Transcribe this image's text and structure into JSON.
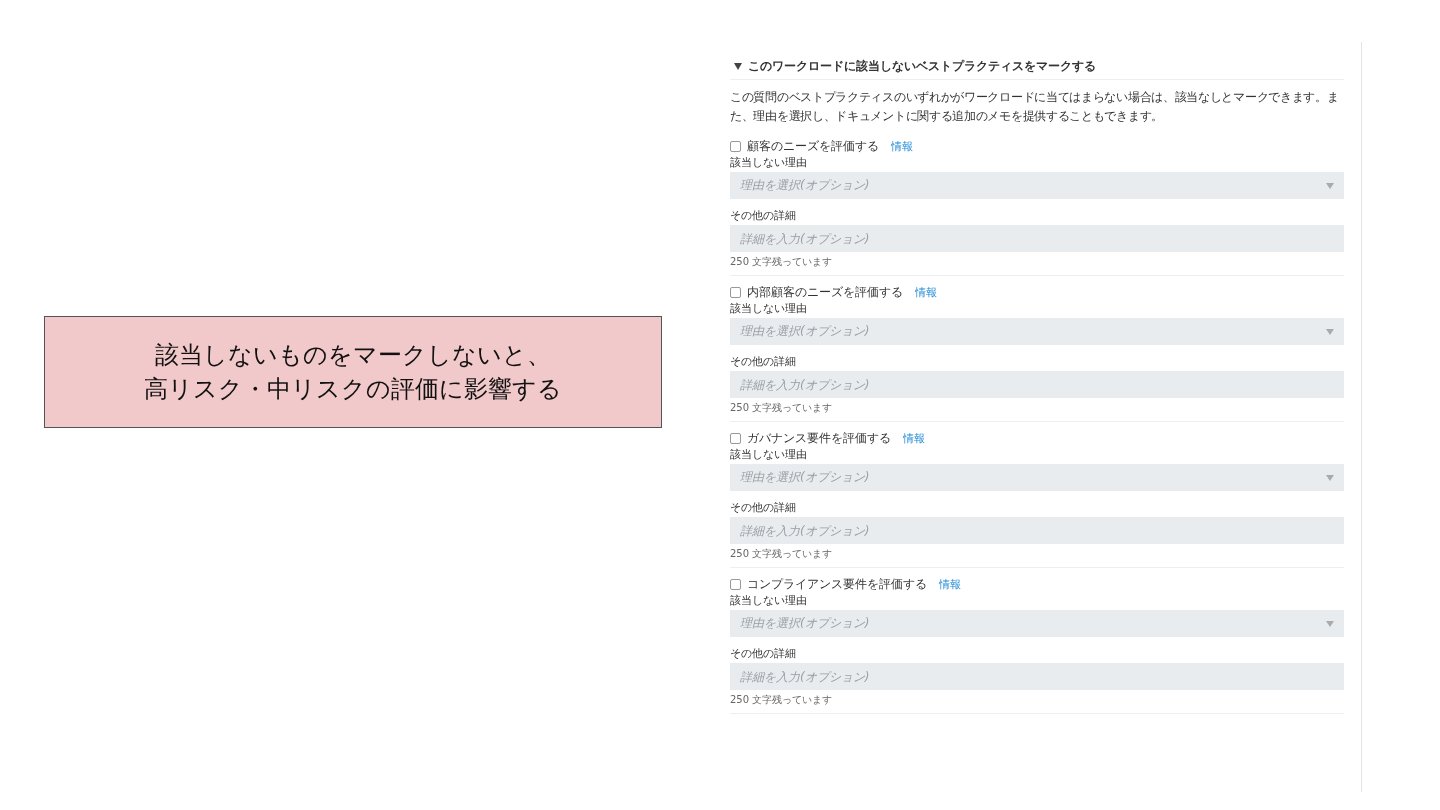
{
  "callout": {
    "lines": [
      "該当しないものをマークしないと、",
      "高リスク・中リスクの評価に影響する"
    ]
  },
  "section": {
    "title": "このワークロードに該当しないベストプラクティスをマークする",
    "expanded": true,
    "description": "この質問のベストプラクティスのいずれかがワークロードに当てはまらない場合は、該当なしとマークできます。また、理由を選択し、ドキュメントに関する追加のメモを提供することもできます。",
    "items": [
      {
        "label": "顧客のニーズを評価する",
        "checked": false,
        "info": "情報",
        "reason_label": "該当しない理由",
        "reason_placeholder": "理由を選択(オプション)",
        "details_label": "その他の詳細",
        "details_placeholder": "詳細を入力(オプション)",
        "counter": "250 文字残っています"
      },
      {
        "label": "内部顧客のニーズを評価する",
        "checked": false,
        "info": "情報",
        "reason_label": "該当しない理由",
        "reason_placeholder": "理由を選択(オプション)",
        "details_label": "その他の詳細",
        "details_placeholder": "詳細を入力(オプション)",
        "counter": "250 文字残っています"
      },
      {
        "label": "ガバナンス要件を評価する",
        "checked": false,
        "info": "情報",
        "reason_label": "該当しない理由",
        "reason_placeholder": "理由を選択(オプション)",
        "details_label": "その他の詳細",
        "details_placeholder": "詳細を入力(オプション)",
        "counter": "250 文字残っています"
      },
      {
        "label": "コンプライアンス要件を評価する",
        "checked": false,
        "info": "情報",
        "reason_label": "該当しない理由",
        "reason_placeholder": "理由を選択(オプション)",
        "details_label": "その他の詳細",
        "details_placeholder": "詳細を入力(オプション)",
        "counter": "250 文字残っています"
      }
    ]
  }
}
